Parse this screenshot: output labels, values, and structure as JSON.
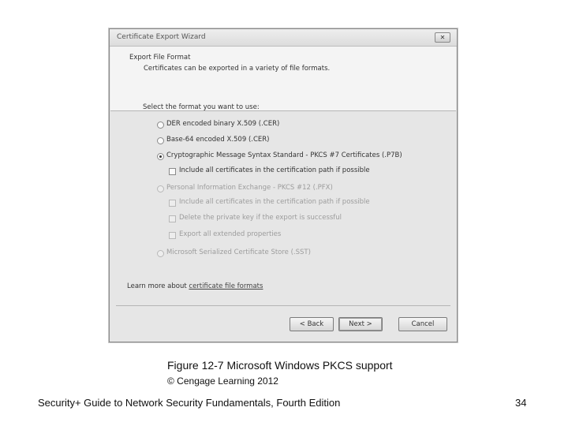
{
  "dialog": {
    "title": "Certificate Export Wizard",
    "close_symbol": "✕",
    "section_title": "Export File Format",
    "section_subtitle": "Certificates can be exported in a variety of file formats.",
    "select_label": "Select the format you want to use:",
    "options": [
      {
        "label": "DER encoded binary X.509 (.CER)",
        "checked": false,
        "enabled": true
      },
      {
        "label": "Base-64 encoded X.509 (.CER)",
        "checked": false,
        "enabled": true
      },
      {
        "label": "Cryptographic Message Syntax Standard - PKCS #7 Certificates (.P7B)",
        "checked": true,
        "enabled": true
      },
      {
        "label": "Personal Information Exchange - PKCS #12 (.PFX)",
        "checked": false,
        "enabled": false
      },
      {
        "label": "Microsoft Serialized Certificate Store (.SST)",
        "checked": false,
        "enabled": false
      }
    ],
    "p7b_checkbox": "Include all certificates in the certification path if possible",
    "pfx_checkboxes": [
      "Include all certificates in the certification path if possible",
      "Delete the private key if the export is successful",
      "Export all extended properties"
    ],
    "learn_more_prefix": "Learn more about ",
    "learn_more_link": "certificate file formats",
    "buttons": {
      "back": "< Back",
      "next": "Next >",
      "cancel": "Cancel"
    }
  },
  "caption": {
    "figure": "Figure 12-7 Microsoft Windows PKCS support",
    "copyright": "© Cengage Learning 2012",
    "book": "Security+ Guide to Network Security Fundamentals, Fourth Edition",
    "page_number": "34"
  }
}
